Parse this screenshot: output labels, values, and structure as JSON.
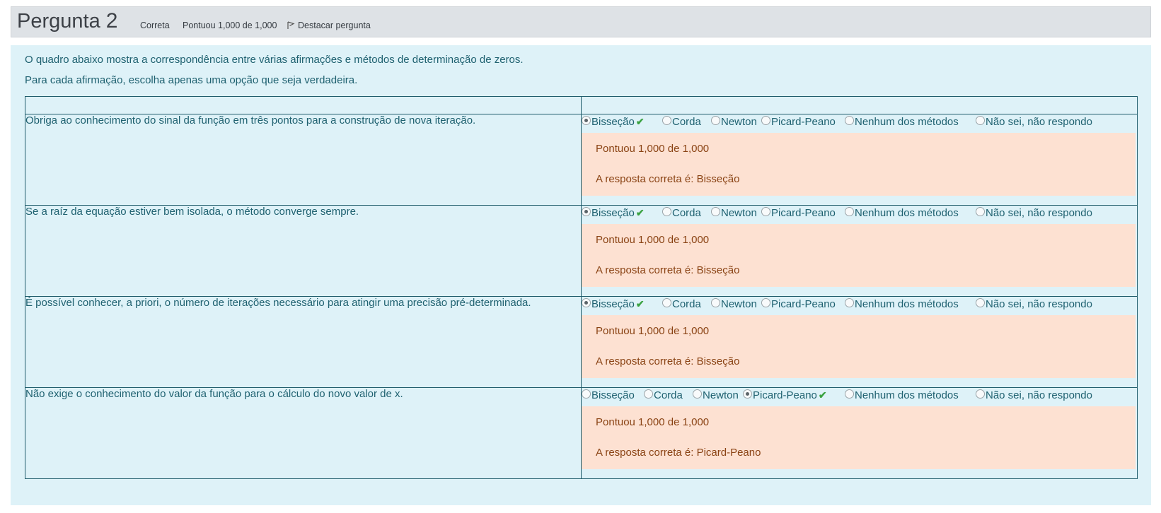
{
  "info": {
    "question_label": "Pergunta",
    "question_number": "2",
    "state": "Correta",
    "grade": "Pontuou 1,000 de 1,000",
    "flag_label": "Destacar pergunta"
  },
  "question": {
    "intro": "O quadro abaixo mostra a correspondência entre várias afirmações e métodos de determinação de zeros.",
    "instruction": "Para cada afirmação, escolha apenas uma opção que seja verdadeira."
  },
  "options": [
    "Bisseção",
    "Corda",
    "Newton",
    "Picard-Peano",
    "Nenhum dos métodos",
    "Não sei, não respondo"
  ],
  "colors": {
    "correct_check": "#3aa241",
    "feedback_bg": "#fde1d2",
    "content_bg": "#def2f8"
  },
  "rows": [
    {
      "statement": "Obriga ao conhecimento do sinal da função em três pontos para a construção de nova iteração.",
      "selected": "Bisseção",
      "score": "Pontuou 1,000 de 1,000",
      "correct": "A resposta correta é: Bisseção"
    },
    {
      "statement": "Se a raíz da equação estiver bem isolada, o método converge sempre.",
      "selected": "Bisseção",
      "score": "Pontuou 1,000 de 1,000",
      "correct": "A resposta correta é: Bisseção"
    },
    {
      "statement": "É possível conhecer, a priori, o número de iterações necessário para atingir uma precisão pré-determinada.",
      "selected": "Bisseção",
      "score": "Pontuou 1,000 de 1,000",
      "correct": "A resposta correta é: Bisseção"
    },
    {
      "statement": "Não exige o conhecimento do valor da função para o cálculo do novo valor de x.",
      "selected": "Picard-Peano",
      "score": "Pontuou 1,000 de 1,000",
      "correct": "A resposta correta é: Picard-Peano"
    }
  ]
}
